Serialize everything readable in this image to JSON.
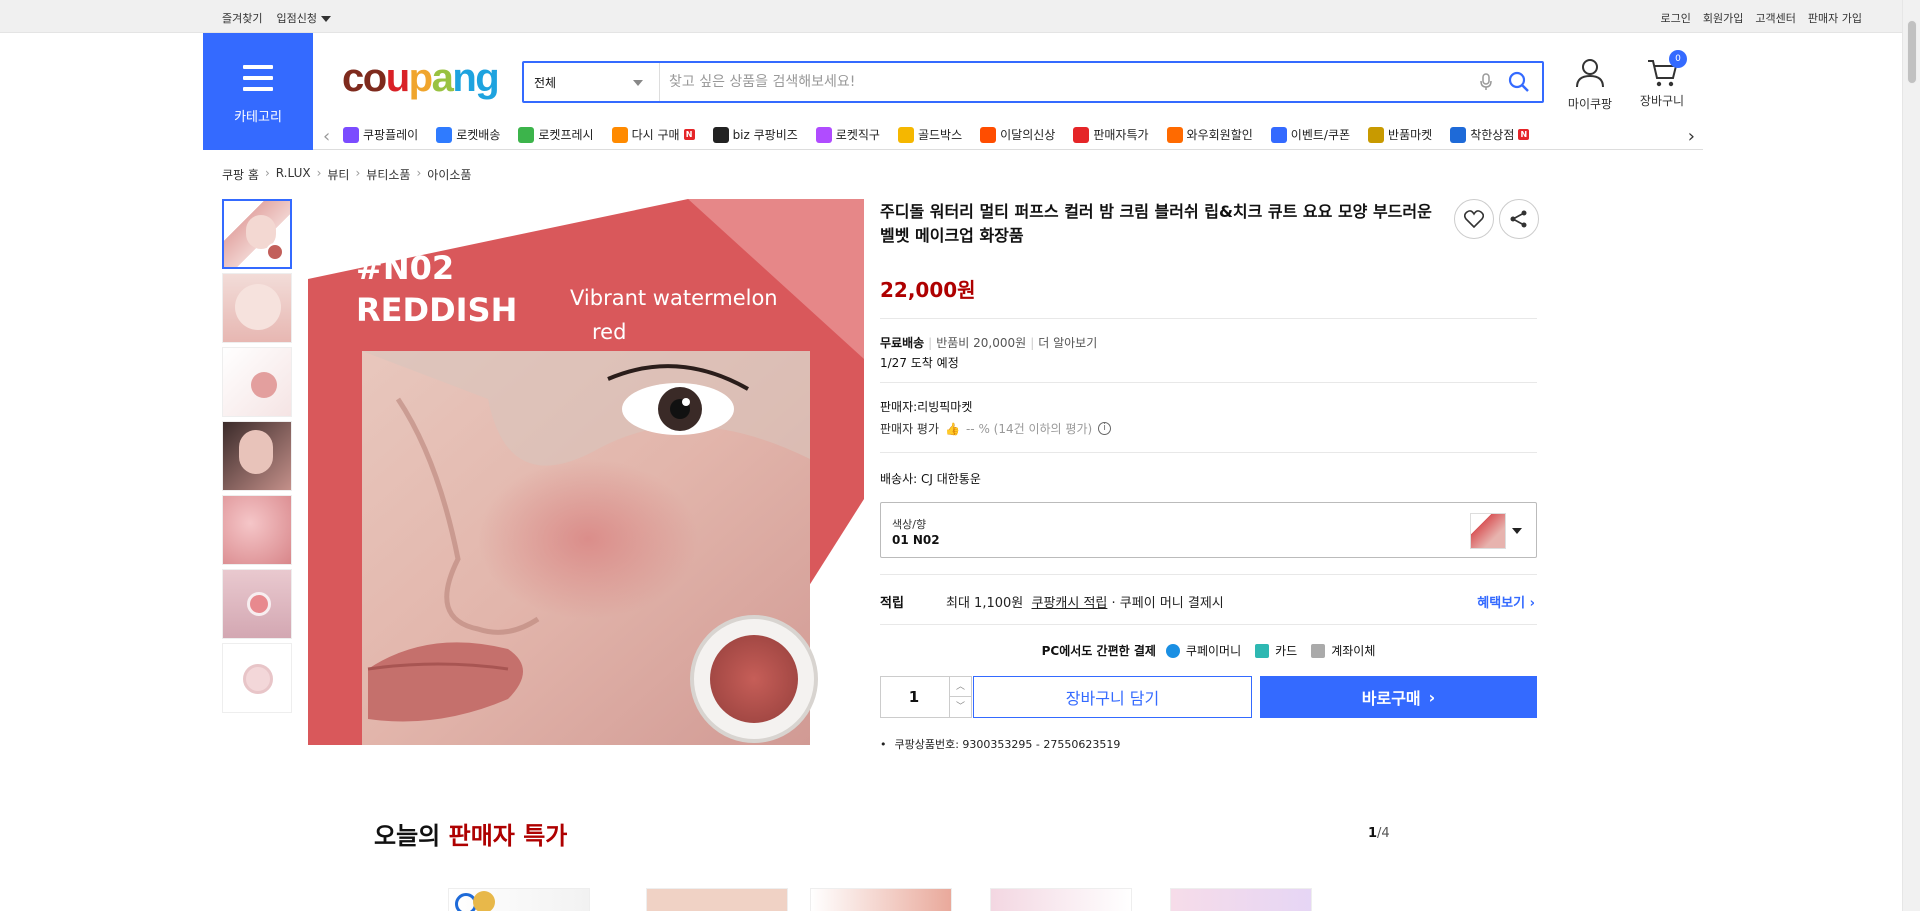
{
  "topbar": {
    "favorites": "즐겨찾기",
    "store_apply": "입점신청",
    "login": "로그인",
    "signup": "회원가입",
    "customer_center": "고객센터",
    "seller_signup": "판매자 가입"
  },
  "header": {
    "category_label": "카테고리",
    "logo_letters": [
      "c",
      "o",
      "u",
      "p",
      "a",
      "n",
      "g"
    ],
    "search_scope": "전체",
    "search_placeholder": "찾고 싶은 상품을 검색해보세요!",
    "my_coupang": "마이쿠팡",
    "cart": "장바구니",
    "cart_count": "0"
  },
  "nav": {
    "items": [
      {
        "label": "쿠팡플레이",
        "color": "#7b4cff"
      },
      {
        "label": "로켓배송",
        "color": "#2f7bff"
      },
      {
        "label": "로켓프레시",
        "color": "#3cb44b"
      },
      {
        "label": "다시 구매",
        "color": "#ff8a00",
        "badge": "N"
      },
      {
        "label": "biz 쿠팡비즈",
        "color": "#222"
      },
      {
        "label": "로켓직구",
        "color": "#b04cff"
      },
      {
        "label": "골드박스",
        "color": "#f5b700"
      },
      {
        "label": "이달의신상",
        "color": "#ff4d00"
      },
      {
        "label": "판매자특가",
        "color": "#e52528"
      },
      {
        "label": "와우회원할인",
        "color": "#ff6a00"
      },
      {
        "label": "이벤트/쿠폰",
        "color": "#346aff"
      },
      {
        "label": "반품마켓",
        "color": "#c89a00"
      },
      {
        "label": "착한상점",
        "color": "#1e6ad8",
        "badge": "N"
      }
    ]
  },
  "breadcrumb": [
    "쿠팡 홈",
    "R.LUX",
    "뷰티",
    "뷰티소품",
    "아이소품"
  ],
  "product": {
    "title": "주디돌 워터리 멀티 퍼프스 컬러 밤 크림 블러쉬 립&치크 큐트 요요 모양 부드러운 벨벳 메이크업 화장품",
    "price": "22,000원",
    "shipping_free": "무료배송",
    "return_fee": "반품비 20,000원",
    "more": "더 알아보기",
    "arrival": "1/27 도착 예정",
    "seller": "판매자:리빙픽마켓",
    "seller_rating_label": "판매자 평가",
    "seller_rating_value": "-- % (14건 이하의 평가)",
    "carrier": "배송사:  CJ 대한통운",
    "option_key": "색상/향",
    "option_value": "01 N02",
    "reward_label": "적립",
    "reward_max": "최대 1,100원",
    "reward_cash": "쿠팡캐시 적립",
    "reward_tail": "· 쿠페이 머니 결제시",
    "reward_link": "혜택보기",
    "pay_title": "PC에서도 간편한 결제",
    "pay_methods": [
      "쿠페이머니",
      "카드",
      "계좌이체"
    ],
    "quantity": "1",
    "add_to_cart": "장바구니 담기",
    "buy_now": "바로구매",
    "product_code": "쿠팡상품번호: 9300353295 - 27550623519"
  },
  "image": {
    "tag_line1": "#N02",
    "tag_line2": "REDDISH",
    "tag_sub1": "Vibrant watermelon",
    "tag_sub2": "red"
  },
  "deals": {
    "title_plain": "오늘의 ",
    "title_red": "판매자 특가",
    "page_current": "1",
    "page_total": "/4"
  },
  "colors": {
    "brand_blue": "#346aff",
    "price_red": "#ae0000"
  }
}
